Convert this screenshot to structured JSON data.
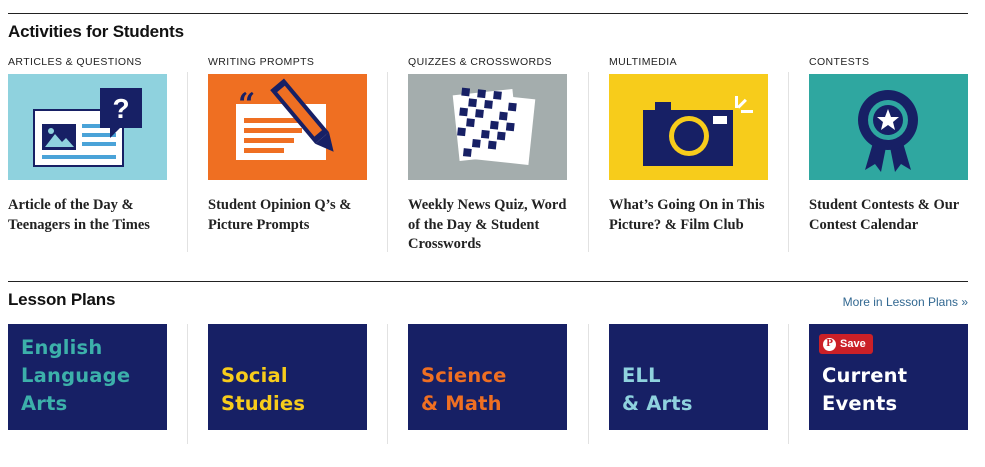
{
  "activities": {
    "title": "Activities for Students",
    "columns": [
      {
        "kicker": "Articles & Questions",
        "headline": "Article of the Day & Teenagers in the Times",
        "icon": "newspaper-question-icon",
        "bg": "#8fd2de"
      },
      {
        "kicker": "Writing Prompts",
        "headline": "Student Opinion Q’s & Picture Prompts",
        "icon": "pencil-quote-icon",
        "bg": "#ef6f22"
      },
      {
        "kicker": "Quizzes & Crosswords",
        "headline": "Weekly News Quiz, Word of the Day & Student Crosswords",
        "icon": "crossword-icon",
        "bg": "#a4adad"
      },
      {
        "kicker": "Multimedia",
        "headline": "What’s Going On in This Picture? & Film Club",
        "icon": "camera-icon",
        "bg": "#f7cc1b"
      },
      {
        "kicker": "Contests",
        "headline": "Student Contests & Our Contest Calendar",
        "icon": "award-ribbon-icon",
        "bg": "#2fa7a0"
      }
    ]
  },
  "lessons": {
    "title": "Lesson Plans",
    "more_link": "More in Lesson Plans »",
    "items": [
      {
        "lines": [
          "English",
          "Language",
          "Arts"
        ],
        "color": "#3cb0aa"
      },
      {
        "lines": [
          "Social",
          "Studies"
        ],
        "color": "#f7cc1b"
      },
      {
        "lines": [
          "Science",
          "& Math"
        ],
        "color": "#ef6f22"
      },
      {
        "lines": [
          "ELL",
          "& Arts"
        ],
        "color": "#8fd2de"
      },
      {
        "lines": [
          "Current",
          "Events"
        ],
        "color": "#ffffff"
      }
    ],
    "save_label": "Save",
    "pin_glyph": "P"
  },
  "colors": {
    "accent_link": "#326891",
    "navy": "#172065",
    "pinterest": "#cb2027"
  }
}
